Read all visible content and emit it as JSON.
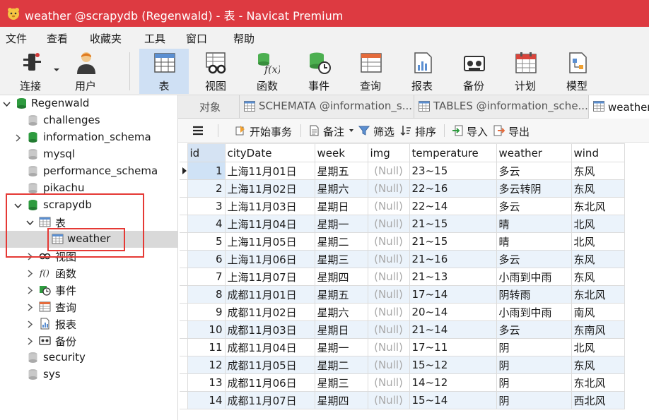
{
  "window": {
    "title": "weather @scrapydb (Regenwald) - 表 - Navicat Premium"
  },
  "menu": [
    "文件",
    "查看",
    "收藏夹",
    "工具",
    "窗口",
    "帮助"
  ],
  "toolbar": {
    "connect": "连接",
    "user": "用户",
    "table": "表",
    "view": "视图",
    "function": "函数",
    "event": "事件",
    "query": "查询",
    "report": "报表",
    "backup": "备份",
    "schedule": "计划",
    "model": "模型"
  },
  "tree": {
    "connection": "Regenwald",
    "dbs": {
      "challenges": "challenges",
      "information_schema": "information_schema",
      "mysql": "mysql",
      "performance_schema": "performance_schema",
      "pikachu": "pikachu",
      "scrapydb": "scrapydb",
      "security": "security",
      "sys": "sys"
    },
    "scrapydb_children": {
      "tables": "表",
      "weather_table": "weather",
      "views": "视图",
      "functions": "函数",
      "events": "事件",
      "queries": "查询",
      "reports": "报表",
      "backups": "备份"
    }
  },
  "tabs": {
    "objects": "对象",
    "schemata": "SCHEMATA @information_s...",
    "tables": "TABLES @information_sche...",
    "weather": "weather @scrapydb (Regenwald) - 表"
  },
  "objtoolbar": {
    "begin_transaction": "开始事务",
    "memo": "备注",
    "filter": "筛选",
    "sort": "排序",
    "import": "导入",
    "export": "导出"
  },
  "grid": {
    "columns": [
      "id",
      "cityDate",
      "week",
      "img",
      "temperature",
      "weather",
      "wind"
    ],
    "null_text": "(Null)",
    "rows": [
      [
        "1",
        "上海11月01日",
        "星期五",
        "(Null)",
        "23~15",
        "多云",
        "东风"
      ],
      [
        "2",
        "上海11月02日",
        "星期六",
        "(Null)",
        "22~16",
        "多云转阴",
        "东风"
      ],
      [
        "3",
        "上海11月03日",
        "星期日",
        "(Null)",
        "22~14",
        "多云",
        "东北风"
      ],
      [
        "4",
        "上海11月04日",
        "星期一",
        "(Null)",
        "21~15",
        "晴",
        "北风"
      ],
      [
        "5",
        "上海11月05日",
        "星期二",
        "(Null)",
        "21~15",
        "晴",
        "北风"
      ],
      [
        "6",
        "上海11月06日",
        "星期三",
        "(Null)",
        "21~16",
        "多云",
        "东风"
      ],
      [
        "7",
        "上海11月07日",
        "星期四",
        "(Null)",
        "21~13",
        "小雨到中雨",
        "东风"
      ],
      [
        "8",
        "成都11月01日",
        "星期五",
        "(Null)",
        "17~14",
        "阴转雨",
        "东北风"
      ],
      [
        "9",
        "成都11月02日",
        "星期六",
        "(Null)",
        "20~14",
        "小雨到中雨",
        "南风"
      ],
      [
        "10",
        "成都11月03日",
        "星期日",
        "(Null)",
        "21~14",
        "多云",
        "东南风"
      ],
      [
        "11",
        "成都11月04日",
        "星期一",
        "(Null)",
        "17~11",
        "阴",
        "北风"
      ],
      [
        "12",
        "成都11月05日",
        "星期二",
        "(Null)",
        "15~12",
        "阴",
        "东风"
      ],
      [
        "13",
        "成都11月06日",
        "星期三",
        "(Null)",
        "14~12",
        "阴",
        "东北风"
      ],
      [
        "14",
        "成都11月07日",
        "星期四",
        "(Null)",
        "15~14",
        "阴",
        "西北风"
      ]
    ]
  },
  "colors": {
    "titlebar": "#dd3a41",
    "active_tool": "#cfe0f4",
    "annotation_box": "#e53935",
    "db_icon_green": "#2e9b3f",
    "row_alt": "#ebf3fb"
  }
}
